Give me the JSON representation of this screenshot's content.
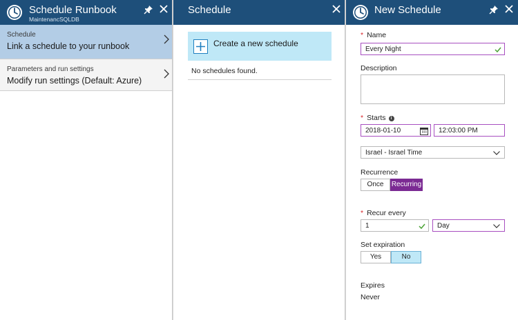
{
  "blade1": {
    "title": "Schedule Runbook",
    "subtitle": "MaintenancSQLDB",
    "items": [
      {
        "label": "Schedule",
        "value": "Link a schedule to your runbook"
      },
      {
        "label": "Parameters and run settings",
        "value": "Modify run settings (Default: Azure)"
      }
    ]
  },
  "blade2": {
    "title": "Schedule",
    "create_label": "Create a new schedule",
    "empty_text": "No schedules found."
  },
  "blade3": {
    "title": "New Schedule",
    "name_label": "Name",
    "name_value": "Every Night",
    "description_label": "Description",
    "description_value": "",
    "starts_label": "Starts",
    "start_date": "2018-01-10",
    "start_time": "12:03:00 PM",
    "timezone": "Israel - Israel Time",
    "recurrence_label": "Recurrence",
    "recurrence_options": [
      "Once",
      "Recurring"
    ],
    "recurrence_selected": "Recurring",
    "recur_every_label": "Recur every",
    "recur_every_value": "1",
    "recur_unit": "Day",
    "expiration_label": "Set expiration",
    "expiration_options": [
      "Yes",
      "No"
    ],
    "expiration_selected": "No",
    "expires_label": "Expires",
    "expires_value": "Never"
  },
  "icons": {
    "clock": "clock-icon",
    "pin": "pin-icon",
    "close": "close-icon",
    "chevron": "chevron-right-icon",
    "plus": "plus-icon",
    "check": "checkmark-icon",
    "calendar": "calendar-icon",
    "caret": "chevron-down-icon",
    "info": "info-icon"
  },
  "colors": {
    "header_bg": "#1e4f7a",
    "selected_nav": "#b3cde6",
    "create_bg": "#bfe8f7",
    "required_star": "#d9262a",
    "recurring_selected": "#7b2a93",
    "valid_check": "#4aa235"
  }
}
